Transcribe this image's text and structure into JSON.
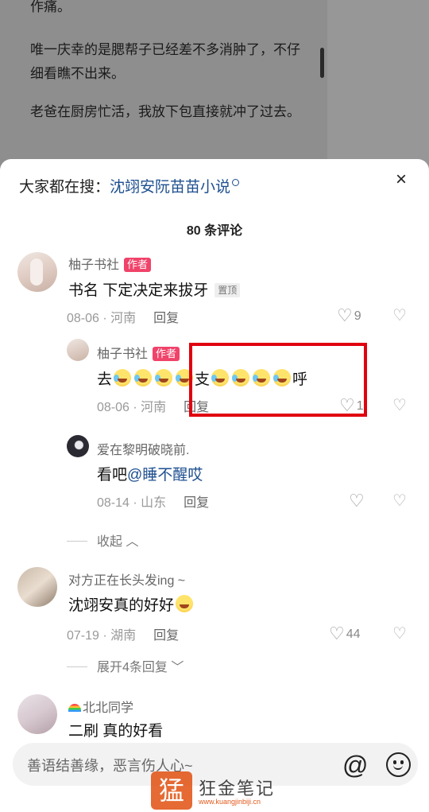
{
  "reader": {
    "line1": "作痛。",
    "para2": "唯一庆幸的是腮帮子已经差不多消肿了，不仔细看瞧不出来。",
    "para3": "老爸在厨房忙活，我放下包直接就冲了过去。"
  },
  "header": {
    "hot_prefix": "大家都在搜：",
    "hot_keyword": "沈翊安阮苗苗小说",
    "close_icon": "×",
    "comment_count": "80 条评论"
  },
  "comments": [
    {
      "user": "柚子书社",
      "badge": "作者",
      "text": "书名  下定决定来拔牙",
      "pin": "置顶",
      "date": "08-06 · 河南",
      "reply": "回复",
      "likes": "9"
    },
    {
      "user": "柚子书社",
      "badge": "作者",
      "text_a": "去",
      "text_b": "支",
      "text_c": "呼",
      "date": "08-06 · 河南",
      "reply": "回复",
      "likes": "1"
    },
    {
      "user": "爱在黎明破晓前.",
      "text": "看吧",
      "mention": "@睡不醒哎",
      "date": "08-14 · 山东",
      "reply": "回复"
    },
    {
      "user": "对方正在长头发ing ~",
      "text": "沈翊安真的好好",
      "date": "07-19 · 湖南",
      "reply": "回复",
      "likes": "44"
    },
    {
      "user": "北北同学",
      "text": "二刷 真的好看"
    }
  ],
  "folds": {
    "collapse": "收起",
    "expand": "展开4条回复"
  },
  "input": {
    "placeholder": "善语结善缘，恶言伤人心~"
  },
  "watermark": {
    "logo_char": "猛",
    "text": "狂金笔记",
    "sub": "www.kuangjinbiji.cn"
  },
  "icons": {
    "like": "heart-outline-icon",
    "dislike": "broken-heart-icon",
    "at": "at-icon",
    "emoji": "smile-icon",
    "search": "search-icon"
  },
  "colors": {
    "author_badge": "#f0436a",
    "link": "#1d4f8f",
    "highlight_box": "#e00010"
  }
}
